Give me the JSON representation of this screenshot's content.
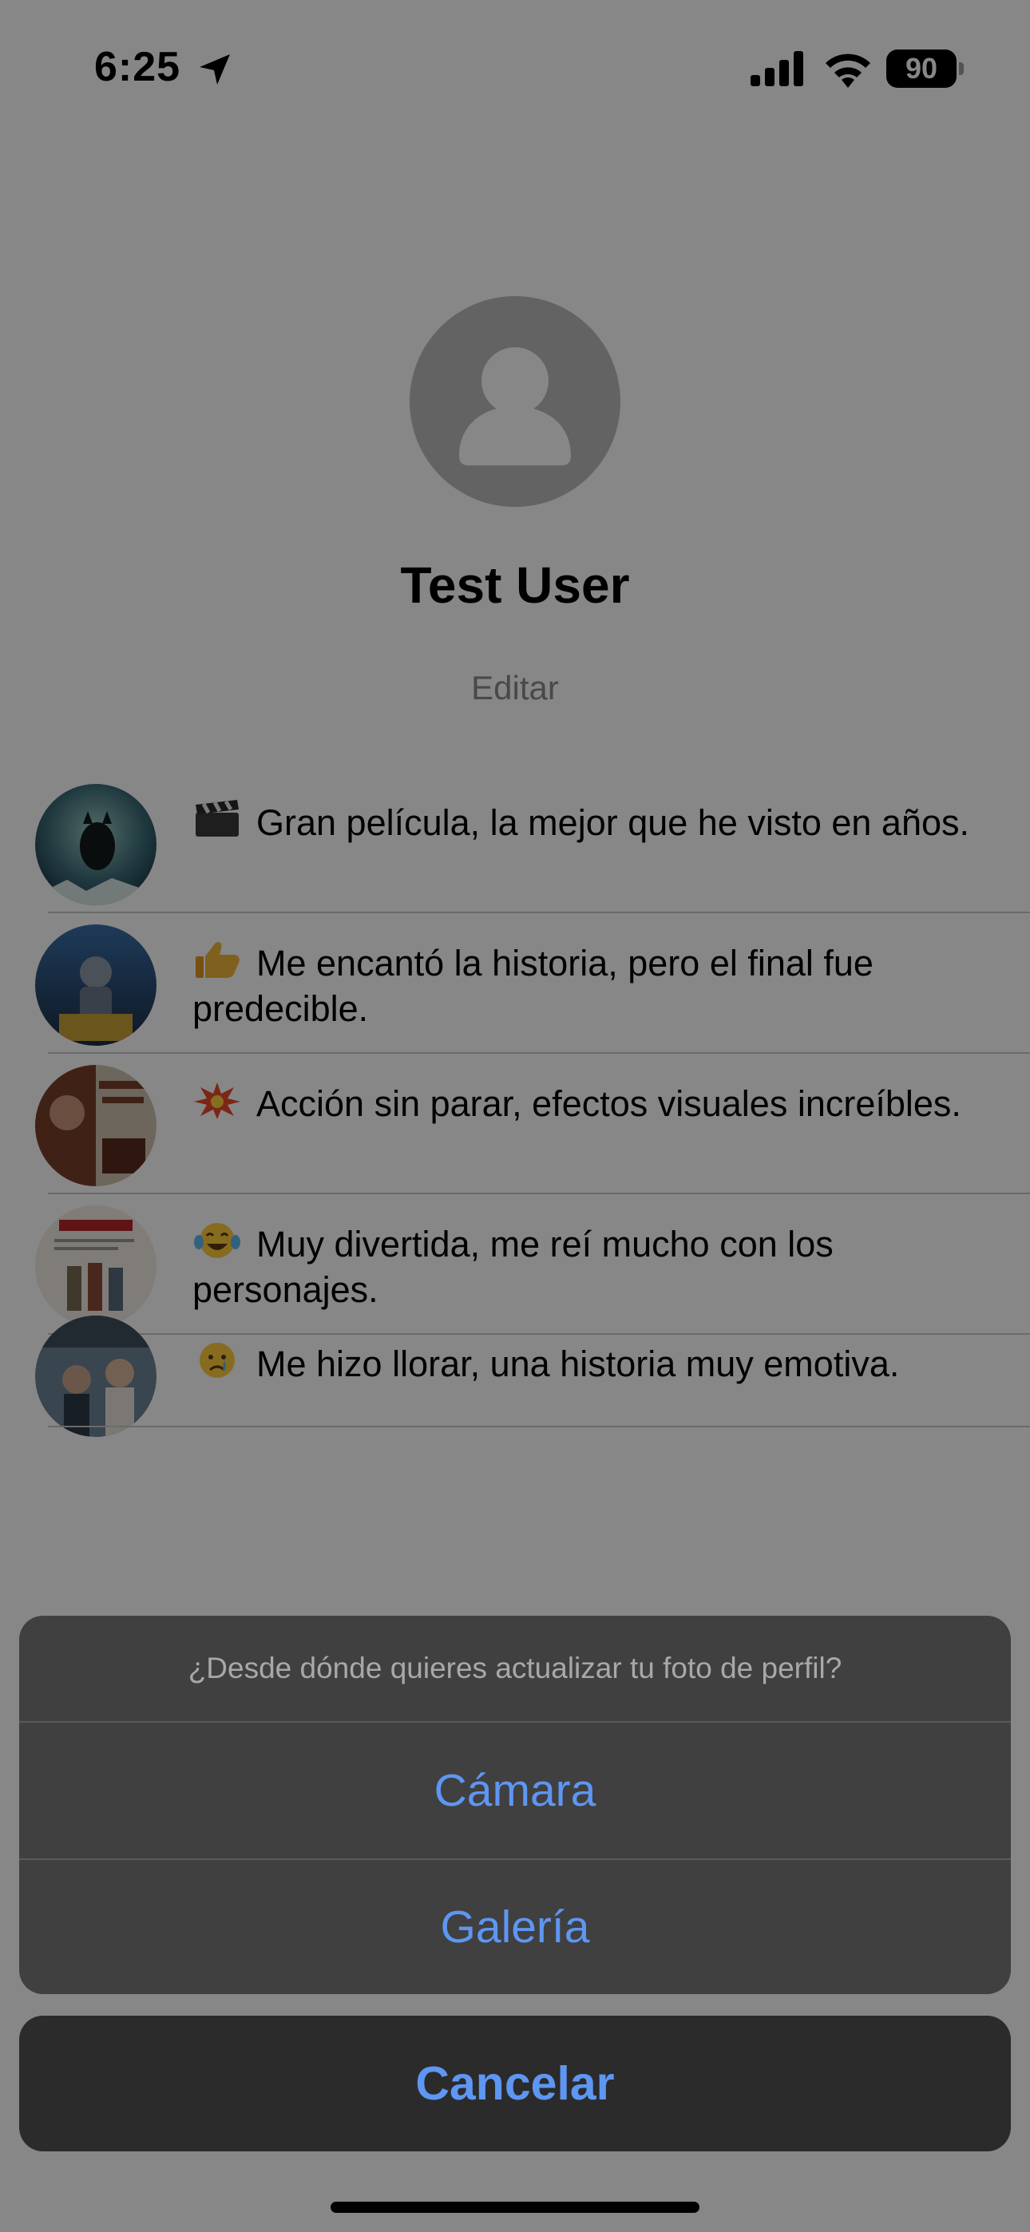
{
  "status_bar": {
    "time": "6:25",
    "battery_level": "90",
    "icons": [
      "location-arrow-icon",
      "cellular-signal-icon",
      "wifi-icon",
      "battery-icon"
    ]
  },
  "profile": {
    "name": "Test User",
    "edit_label": "Editar",
    "avatar_icon": "person-placeholder-icon"
  },
  "reviews": [
    {
      "poster": "Flow",
      "emoji": "clapper-board",
      "text": "Gran película, la mejor que he visto en años."
    },
    {
      "poster": "Robot Salvaje",
      "emoji": "thumbs-up",
      "text": "Me encantó la historia, pero el final fue predecible."
    },
    {
      "poster": "Killers of the Flower Moon",
      "emoji": "collision",
      "text": "Acción sin parar, efectos visuales increíbles."
    },
    {
      "poster": "Holdovers",
      "emoji": "tears-of-joy",
      "text": "Muy divertida, me reí mucho con los personajes."
    },
    {
      "poster": "Past Lives",
      "emoji": "crying-face",
      "text": "Me hizo llorar, una historia muy emotiva."
    }
  ],
  "action_sheet": {
    "title": "¿Desde dónde quieres actualizar tu foto de perfil?",
    "options": [
      "Cámara",
      "Galería"
    ],
    "cancel_label": "Cancelar"
  },
  "colors": {
    "action_blue": "#5e96f2",
    "sheet_background": "#404040",
    "cancel_background": "#2b2b2b",
    "avatar_gray": "#bcbcbc",
    "edit_gray": "#8a8a8a"
  }
}
